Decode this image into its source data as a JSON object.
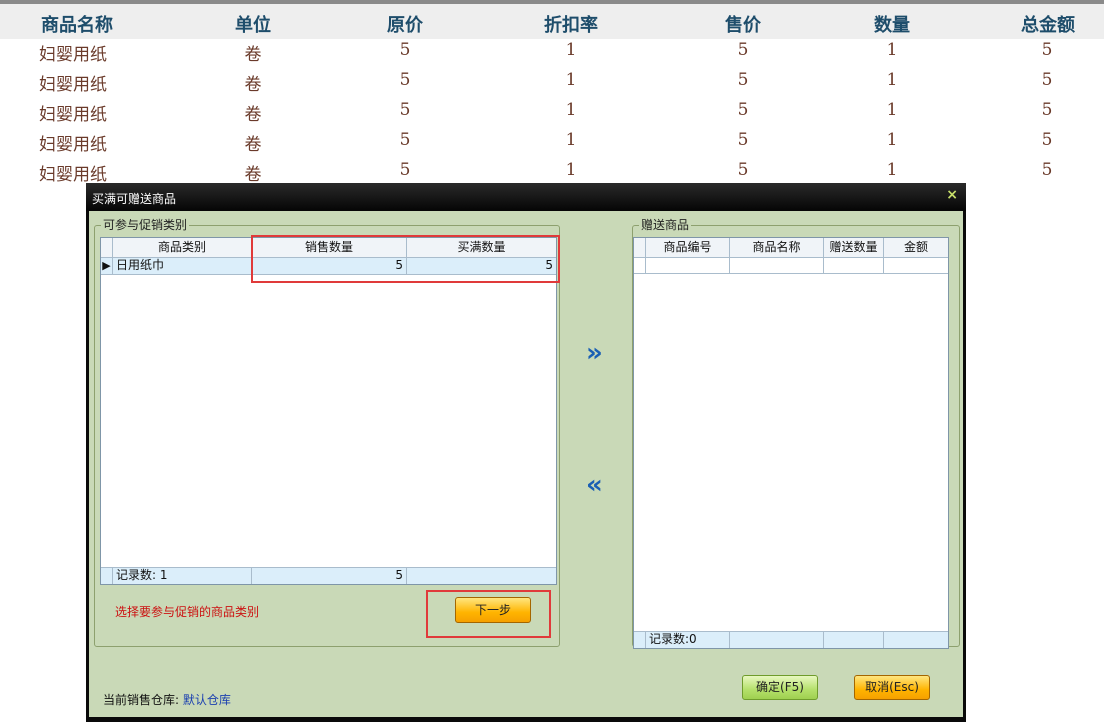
{
  "list": {
    "headers": [
      "商品名称",
      "单位",
      "原价",
      "折扣率",
      "售价",
      "数量",
      "总金额"
    ],
    "rows": [
      [
        "妇婴用纸",
        "卷",
        "5",
        "1",
        "5",
        "1",
        "5"
      ],
      [
        "妇婴用纸",
        "卷",
        "5",
        "1",
        "5",
        "1",
        "5"
      ],
      [
        "妇婴用纸",
        "卷",
        "5",
        "1",
        "5",
        "1",
        "5"
      ],
      [
        "妇婴用纸",
        "卷",
        "5",
        "1",
        "5",
        "1",
        "5"
      ],
      [
        "妇婴用纸",
        "卷",
        "5",
        "1",
        "5",
        "1",
        "5"
      ]
    ]
  },
  "dialog": {
    "title": "买满可赠送商品",
    "close_glyph": "×",
    "left_group": {
      "title": "可参与促销类别",
      "columns": [
        "商品类别",
        "销售数量",
        "买满数量"
      ],
      "rows": [
        {
          "indicator": "▶",
          "category": "日用纸巾",
          "sales_qty": "5",
          "buy_qty": "5"
        }
      ],
      "footer": {
        "record_label": "记录数: 1",
        "sales_total": "5",
        "buy_total": ""
      }
    },
    "right_group": {
      "title": "赠送商品",
      "columns": [
        "商品编号",
        "商品名称",
        "赠送数量",
        "金额"
      ],
      "footer": {
        "record_label": "记录数:0"
      }
    },
    "move_right_glyph": "»",
    "move_left_glyph": "«",
    "hint": "选择要参与促销的商品类别",
    "next_button": "下一步",
    "warehouse_label": "当前销售仓库:",
    "warehouse_value": "默认仓库",
    "confirm_button": "确定(F5)",
    "cancel_button": "取消(Esc)"
  }
}
